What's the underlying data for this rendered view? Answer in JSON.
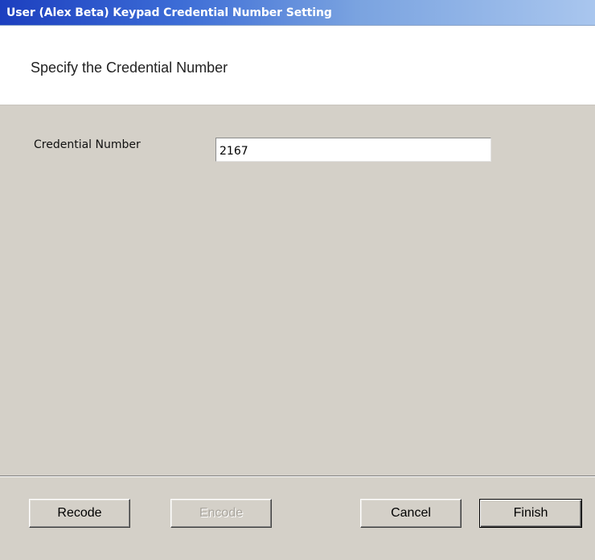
{
  "window": {
    "title": "User (Alex Beta) Keypad Credential Number Setting"
  },
  "header": {
    "title": "Specify the Credential Number"
  },
  "form": {
    "credential_label": "Credential Number",
    "credential_value": "2167"
  },
  "buttons": {
    "recode": "Recode",
    "encode": "Encode",
    "cancel": "Cancel",
    "finish": "Finish"
  },
  "colors": {
    "dialog_background": "#d4d0c8",
    "header_background": "#ffffff",
    "title_text": "#ffffff",
    "disabled_text": "#a8a49c"
  }
}
